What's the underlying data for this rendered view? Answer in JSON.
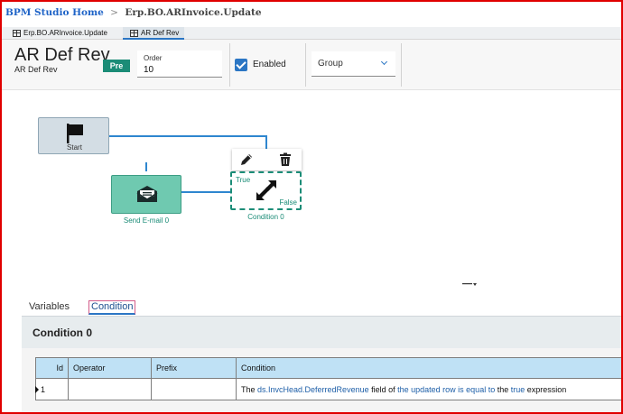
{
  "breadcrumb": {
    "home": "BPM Studio Home",
    "separator": ">",
    "current": "Erp.BO.ARInvoice.Update"
  },
  "tabs": [
    {
      "label": "Erp.BO.ARInvoice.Update",
      "icon": "table-icon",
      "active": false
    },
    {
      "label": "AR Def Rev",
      "icon": "table-icon",
      "active": true
    }
  ],
  "header": {
    "title": "AR Def Rev",
    "subtitle": "AR Def Rev",
    "badge": "Pre",
    "order_label": "Order",
    "order_value": "10",
    "enabled_label": "Enabled",
    "enabled_checked": true,
    "group_value": "Group"
  },
  "canvas": {
    "nodes": [
      {
        "id": "start",
        "label": "Start",
        "icon": "flag-icon"
      },
      {
        "id": "send-email",
        "label": "Send E-mail 0",
        "icon": "envelope-icon"
      },
      {
        "id": "condition",
        "label": "Condition 0",
        "icon": "condition-arrows-icon",
        "true_label": "True",
        "false_label": "False"
      }
    ],
    "toolbar": [
      "pencil-icon",
      "trash-icon"
    ]
  },
  "panel": {
    "tabs": [
      "Variables",
      "Condition"
    ],
    "active_tab": "Condition",
    "section_title": "Condition 0",
    "columns": [
      "Id",
      "Operator",
      "Prefix",
      "Condition"
    ],
    "rows": [
      {
        "id": "1",
        "operator": "",
        "prefix": "",
        "condition": {
          "t1": "The ",
          "field": "ds.InvcHead.DeferredRevenue",
          "t2": " field of ",
          "row_expr": "the updated row is equal to",
          "t3": " the ",
          "value": "true",
          "t4": " expression"
        }
      }
    ]
  },
  "colors": {
    "accent": "#2b76c4",
    "teal": "#1b8c77",
    "connector": "#2e86cf",
    "frame": "#e00000"
  }
}
